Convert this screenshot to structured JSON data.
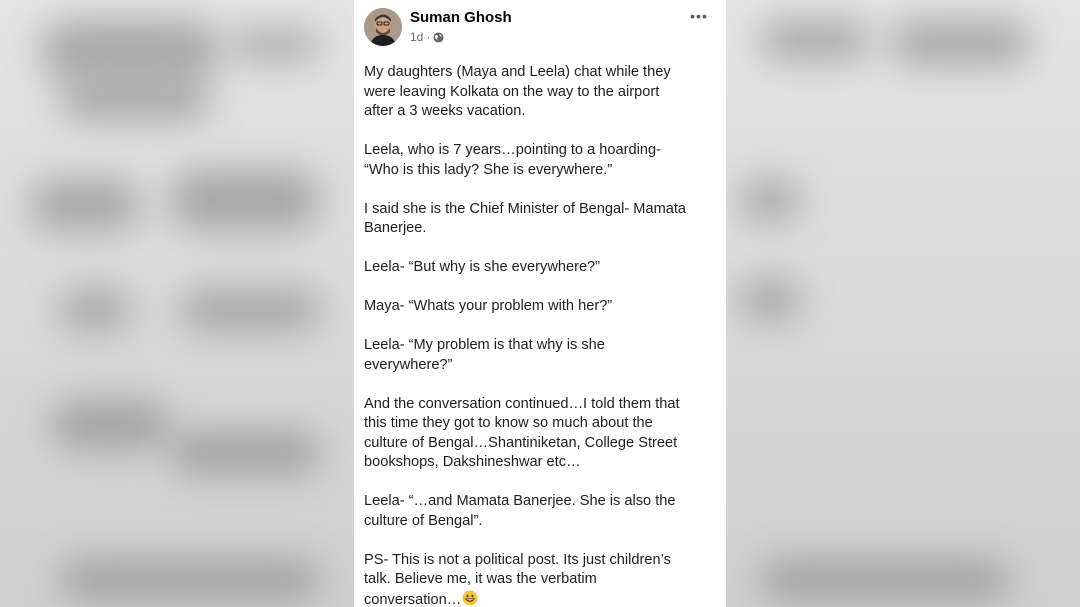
{
  "post": {
    "author": "Suman Ghosh",
    "time": "1d",
    "separator": "·",
    "visibility_icon": "globe-icon",
    "more_label": "•••",
    "paragraphs": [
      "My daughters (Maya and Leela) chat while they\nwere leaving Kolkata on the way to the airport\nafter a 3 weeks vacation.",
      "Leela, who is 7 years…pointing to a hoarding-\n“Who is this lady? She is everywhere.”",
      "I said she is the Chief Minister of Bengal- Mamata\nBanerjee.",
      "Leela- “But why is she everywhere?”",
      "Maya- “Whats your problem with her?”",
      "Leela- “My problem is that why is she\neverywhere?”",
      "And the conversation continued…I told them that\nthis time they got to know so much about the\nculture of Bengal…Shantiniketan, College Street\nbookshops, Dakshineshwar etc…",
      "Leela- “…and Mamata Banerjee. She is also the\nculture of Bengal”.",
      "PS- This is not a political post. Its just children’s\ntalk. Believe me, it was the verbatim\nconversation…"
    ],
    "emoji_icon": "grinning-face-emoji"
  },
  "colors": {
    "card_bg": "#ffffff",
    "text": "#1c1e21",
    "meta": "#65676b",
    "page_bg": "#d8d8d8"
  }
}
